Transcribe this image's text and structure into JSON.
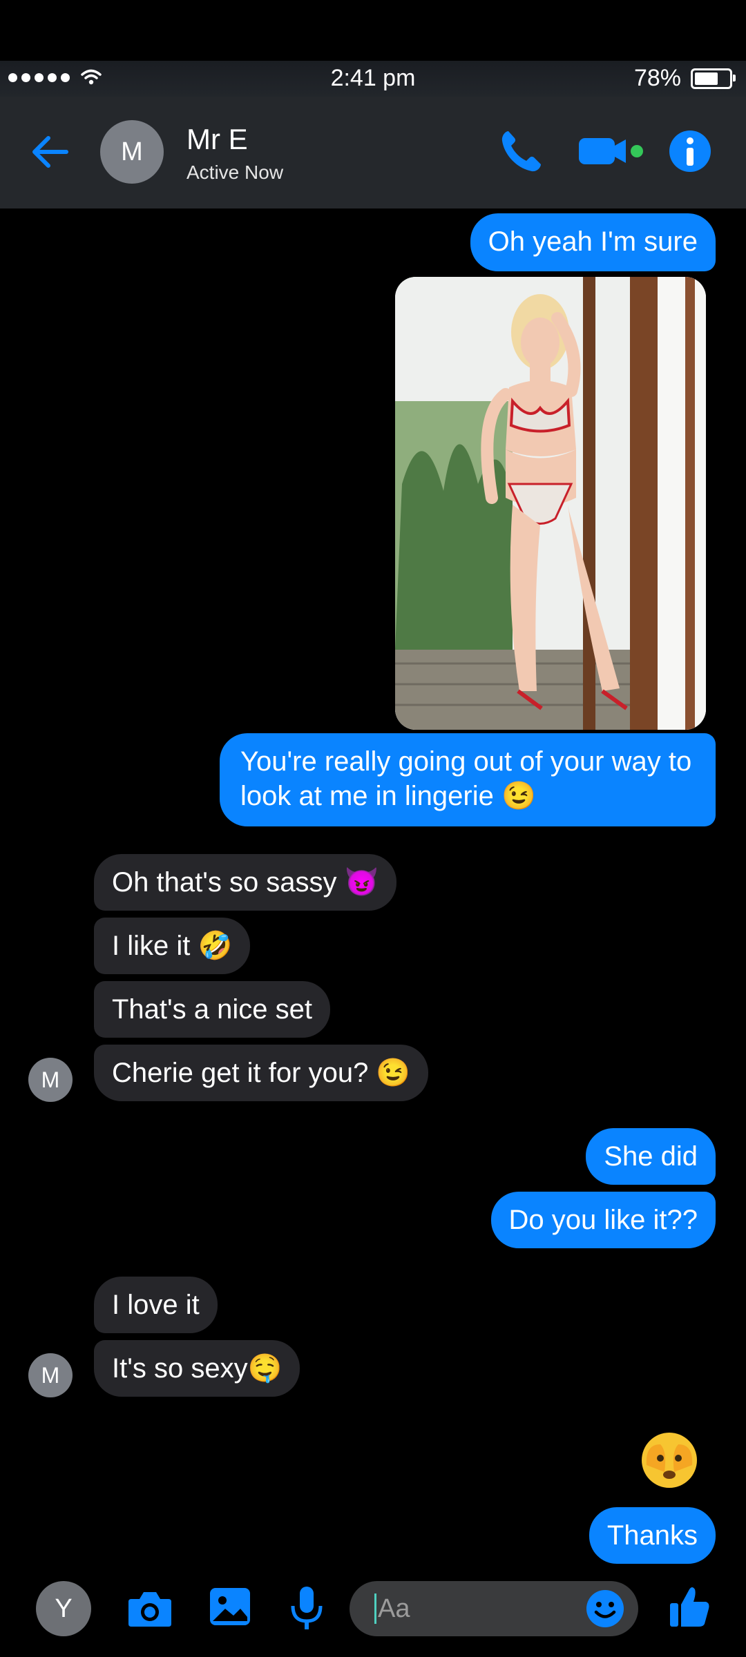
{
  "status_bar": {
    "time": "2:41 pm",
    "battery": "78%",
    "battery_level": 0.78
  },
  "header": {
    "avatar_letter": "M",
    "contact_name": "Mr E",
    "contact_status": "Active Now"
  },
  "messages": [
    {
      "from": "me",
      "text": "Oh yeah I'm sure"
    },
    {
      "from": "me",
      "type": "photo"
    },
    {
      "from": "me",
      "text": "You're really going out of your way to look at me in lingerie 😉"
    },
    {
      "from": "them",
      "text": "Oh that's so sassy 😈"
    },
    {
      "from": "them",
      "text": "I like it 🤣"
    },
    {
      "from": "them",
      "text": "That's a nice set"
    },
    {
      "from": "them",
      "text": "Cherie get it for you? 😉"
    },
    {
      "from": "me",
      "text": "She did"
    },
    {
      "from": "me",
      "text": "Do you like it??"
    },
    {
      "from": "them",
      "text": "I love it"
    },
    {
      "from": "them",
      "text": "It's so sexy🤤"
    },
    {
      "from": "me",
      "type": "emoji",
      "icon": "see-no-evil-face"
    },
    {
      "from": "me",
      "text": "Thanks"
    }
  ],
  "avatars": {
    "them": "M",
    "me": "Y"
  },
  "composer": {
    "placeholder": "Aa"
  },
  "colors": {
    "accent": "#0a84ff",
    "them_bubble": "#26262a",
    "header_bg": "#25282c",
    "video_dot": "#34c759"
  }
}
